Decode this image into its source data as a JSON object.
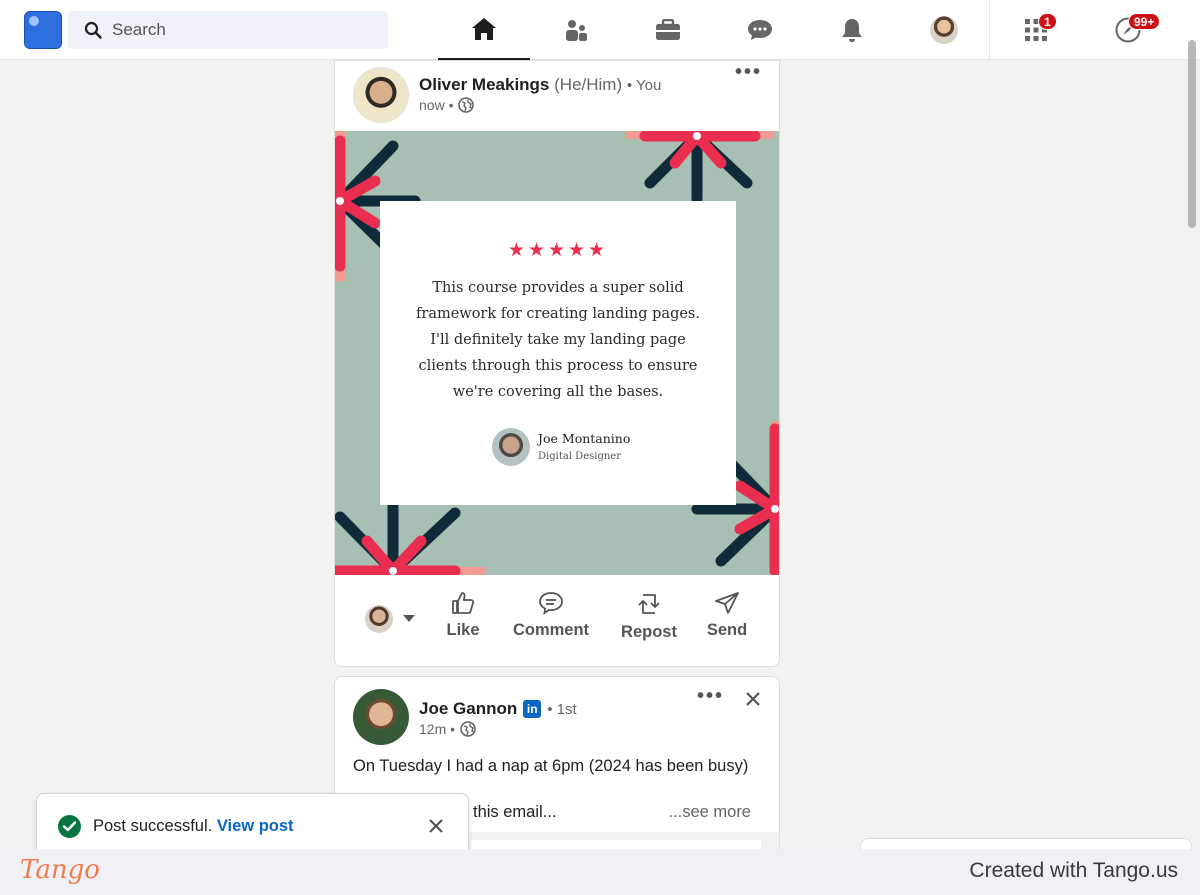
{
  "nav": {
    "search_placeholder": "Search",
    "icons": [
      "home-icon",
      "my-network-icon",
      "jobs-icon",
      "messaging-icon",
      "notifications-icon",
      "me-avatar",
      "apps-grid-icon",
      "advertise-icon"
    ],
    "apps_badge": "1",
    "advertise_badge": "99+",
    "badge_color": "#cc1016"
  },
  "post1": {
    "author_name": "Oliver Meakings",
    "pronouns": "(He/Him)",
    "relation": "• You",
    "time": "now •",
    "testimonial": {
      "stars": "★★★★★",
      "quote": "This course provides a super solid framework for creating landing pages. I'll definitely take my landing page clients through this process to ensure we're covering all the bases.",
      "reviewer_name": "Joe Montanino",
      "reviewer_role": "Digital Designer",
      "bg_color": "#a8bfb3",
      "accent_red": "#ea2e4f",
      "accent_navy": "#0f2b3a"
    },
    "actions": {
      "like": "Like",
      "comment": "Comment",
      "repost": "Repost",
      "send": "Send"
    }
  },
  "post2": {
    "author_name": "Joe Gannon",
    "degree": "• 1st",
    "time": "12m •",
    "text_line1": "On Tuesday I had a nap at 6pm (2024 has been busy)",
    "text_line2": "this email...",
    "see_more": "...see more"
  },
  "toast": {
    "message": "Post successful.",
    "link": "View post"
  },
  "footer": {
    "logo": "Tango",
    "credit": "Created with Tango.us"
  }
}
